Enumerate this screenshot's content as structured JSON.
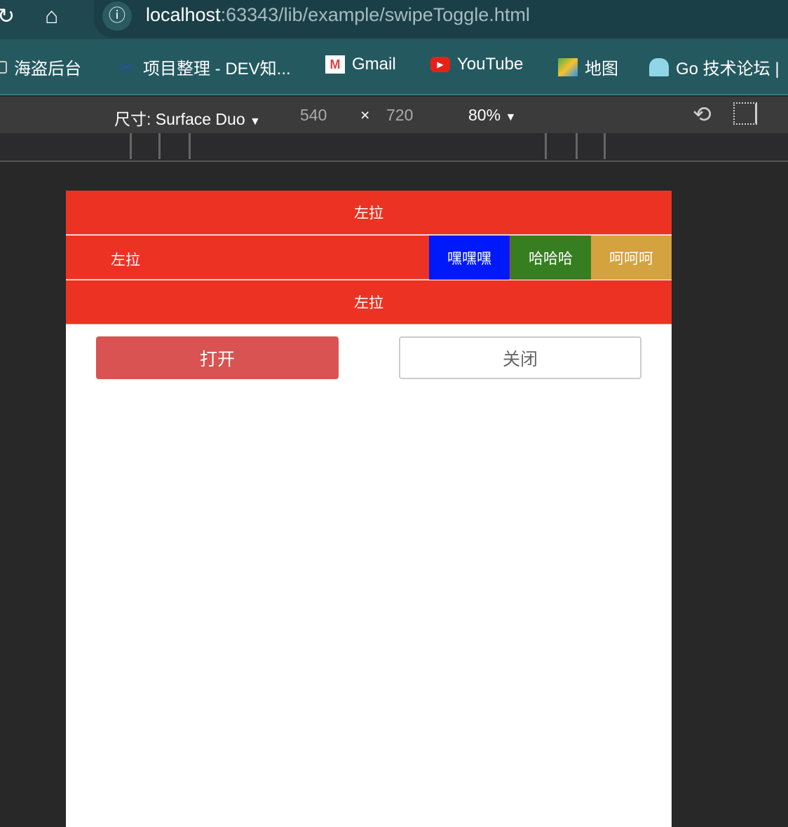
{
  "browser": {
    "url_host": "localhost",
    "url_rest": ":63343/lib/example/swipeToggle.html",
    "bookmarks": [
      {
        "label": "海盗后台",
        "icon": "folder-icon"
      },
      {
        "label": "项目整理 - DEV知...",
        "icon": "scissors-icon"
      },
      {
        "label": "Gmail",
        "icon": "gmail-icon"
      },
      {
        "label": "YouTube",
        "icon": "youtube-icon"
      },
      {
        "label": "地图",
        "icon": "maps-icon"
      },
      {
        "label": "Go 技术论坛 |",
        "icon": "gopher-icon"
      }
    ]
  },
  "devtools": {
    "device": "尺寸: Surface Duo",
    "width": "540",
    "times": "×",
    "height": "720",
    "zoom": "80%"
  },
  "page": {
    "rows": [
      {
        "label": "左拉"
      },
      {
        "label": "左拉",
        "actions": [
          {
            "label": "嘿嘿嘿",
            "color": "#0019fa"
          },
          {
            "label": "哈哈哈",
            "color": "#367e1f"
          },
          {
            "label": "呵呵呵",
            "color": "#d4a23f"
          }
        ]
      },
      {
        "label": "左拉"
      }
    ],
    "open_button": "打开",
    "close_button": "关闭",
    "row_color": "#ec3323",
    "open_color": "#d85352"
  }
}
